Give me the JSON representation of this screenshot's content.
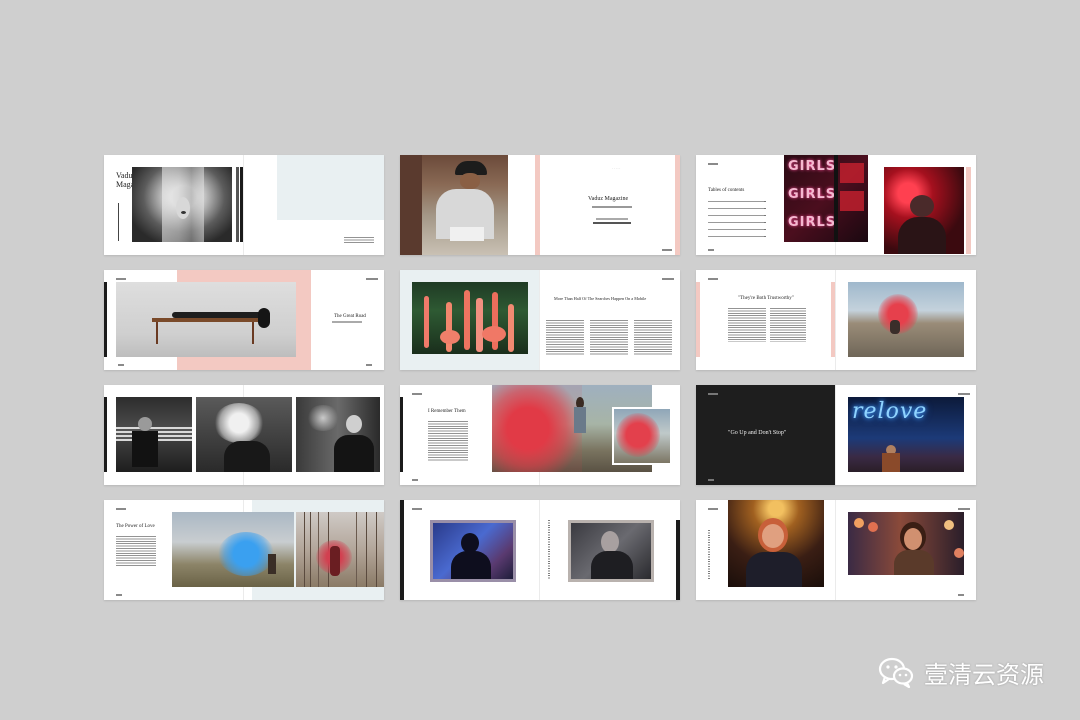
{
  "page": {
    "background": "#cfcfcf"
  },
  "spreads": {
    "s1": {
      "title_line1": "Vaduz",
      "title_line2": "Magazine"
    },
    "s2": {
      "title": "Vaduz Magazine"
    },
    "s3": {
      "toc_title": "Tables of contents",
      "neon_text_1": "GIRLS",
      "neon_text_2": "GIRLS",
      "neon_text_3": "GIRLS"
    },
    "s4": {
      "title": "The Great Road"
    },
    "s5": {
      "title": "More Than Half Of The Searches Happen On a Mobile"
    },
    "s6": {
      "title": "\"They're Both Trustworthy\""
    },
    "s7": {},
    "s8": {
      "title": "I Remember Them"
    },
    "s9": {
      "quote": "\"Go Up and Don't Stop\"",
      "neon_text": "relove"
    },
    "s10": {
      "title": "The Power of Love"
    },
    "s11": {},
    "s12": {}
  },
  "watermark": {
    "text": "壹清云资源",
    "icon": "wechat-icon"
  },
  "colors": {
    "accent_pink": "#f3c9c2",
    "dark_bar": "#1b1b1b",
    "light_blue_panel": "#e9f0f2"
  }
}
